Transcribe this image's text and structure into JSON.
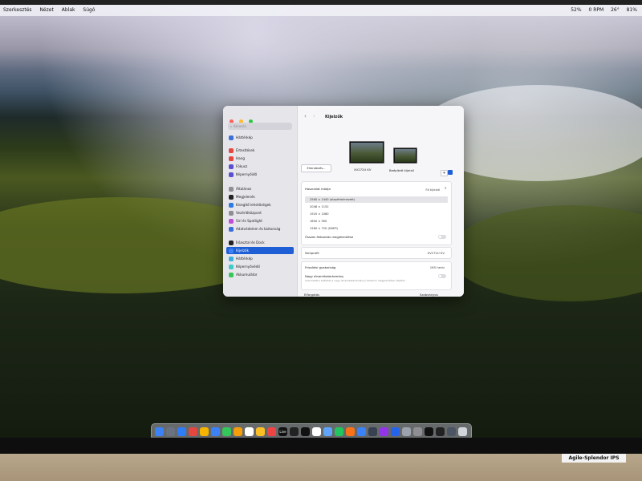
{
  "menubar": {
    "items": [
      "Szerkesztés",
      "Nézet",
      "Ablak",
      "Súgó"
    ],
    "status": [
      "52%",
      "0 RPM",
      "26°",
      "81%"
    ]
  },
  "window": {
    "sidebar": {
      "search_placeholder": "Keresés",
      "items": [
        {
          "label": "Háttérkép",
          "color": "#3b6fd8"
        },
        {
          "label": "Értesítések",
          "color": "#e5463f"
        },
        {
          "label": "Hang",
          "color": "#e5463f"
        },
        {
          "label": "Fókusz",
          "color": "#5a4fcf"
        },
        {
          "label": "Képernyőidő",
          "color": "#5a4fcf"
        },
        {
          "label": "Általános",
          "color": "#8e8e93"
        },
        {
          "label": "Megjelenés",
          "color": "#222222"
        },
        {
          "label": "Kisegítő lehetőségek",
          "color": "#2a7be4"
        },
        {
          "label": "Vezérlőközpont",
          "color": "#8e8e93"
        },
        {
          "label": "Siri és Spotlight",
          "color": "#c04fd6"
        },
        {
          "label": "Adatvédelem és biztonság",
          "color": "#3b6fd8"
        },
        {
          "label": "Íróasztal és Dock",
          "color": "#222222"
        },
        {
          "label": "Kijelzők",
          "color": "#3b82f6"
        },
        {
          "label": "Háttérkép",
          "color": "#3bb0e0"
        },
        {
          "label": "Képernyővédő",
          "color": "#40c9c9"
        },
        {
          "label": "Akkumulátor",
          "color": "#34c759"
        }
      ],
      "active_index": 12
    },
    "title": "Kijelzők",
    "arrange_button": "Elrendezés...",
    "displays": [
      {
        "name": "XV272U KV"
      },
      {
        "name": "Beépített kijelző"
      }
    ],
    "add_button": "+",
    "use_as_label": "Használat módja",
    "use_as_value": "Fő kijelző",
    "resolutions": [
      "2560 × 1440 (alapértelmezett)",
      "2048 × 1152",
      "1920 × 1080",
      "1600 × 900",
      "1280 × 720 (HiDPI)"
    ],
    "selected_resolution": 0,
    "show_all": "Összes felbontás megjelenítése",
    "color_profile_label": "Színprofil",
    "color_profile_value": "XV272U KV",
    "refresh_label": "Frissítési gyakoriság",
    "refresh_value": "165 hertz",
    "hdr_label": "Nagy dinamikatartomány",
    "hdr_desc": "Automatikus beállítás a nagy dinamikatartományú tartalom megjelenítése céljából.",
    "rotation_label": "Elforgatás",
    "rotation_value": "Szabványos"
  },
  "dock": {
    "items": [
      "Finder",
      "Launchpad",
      "Safari",
      "Vivaldi",
      "Chrome",
      "Mail",
      "Üzenetek",
      "Fotók",
      "Naptár",
      "Jegyzetek",
      "Zene",
      "Live",
      "Unity",
      "Terminál",
      "TextEdit",
      "Előnézet",
      "Numbers",
      "Pages",
      "Keynote",
      "Kamera",
      "Podcast",
      "App Store",
      "Szótár",
      "Beállítások",
      "iPhone Tükrözés",
      "Terminál",
      "Konzol",
      "Kuka"
    ],
    "colors": [
      "#3b82f6",
      "#6b7280",
      "#2f7df6",
      "#e5463f",
      "#f4b400",
      "#3b82f6",
      "#34c759",
      "#f59e0b",
      "#ffffff",
      "#fbbf24",
      "#ef4444",
      "#111111",
      "#222222",
      "#111111",
      "#ffffff",
      "#60a5fa",
      "#22c55e",
      "#f97316",
      "#3b82f6",
      "#374151",
      "#9333ea",
      "#2563eb",
      "#9ca3af",
      "#8e8e93",
      "#111111",
      "#222222",
      "#4b5563",
      "#d1d5db"
    ],
    "live_label": "Live"
  },
  "brand": "Agile-Splendor IPS"
}
